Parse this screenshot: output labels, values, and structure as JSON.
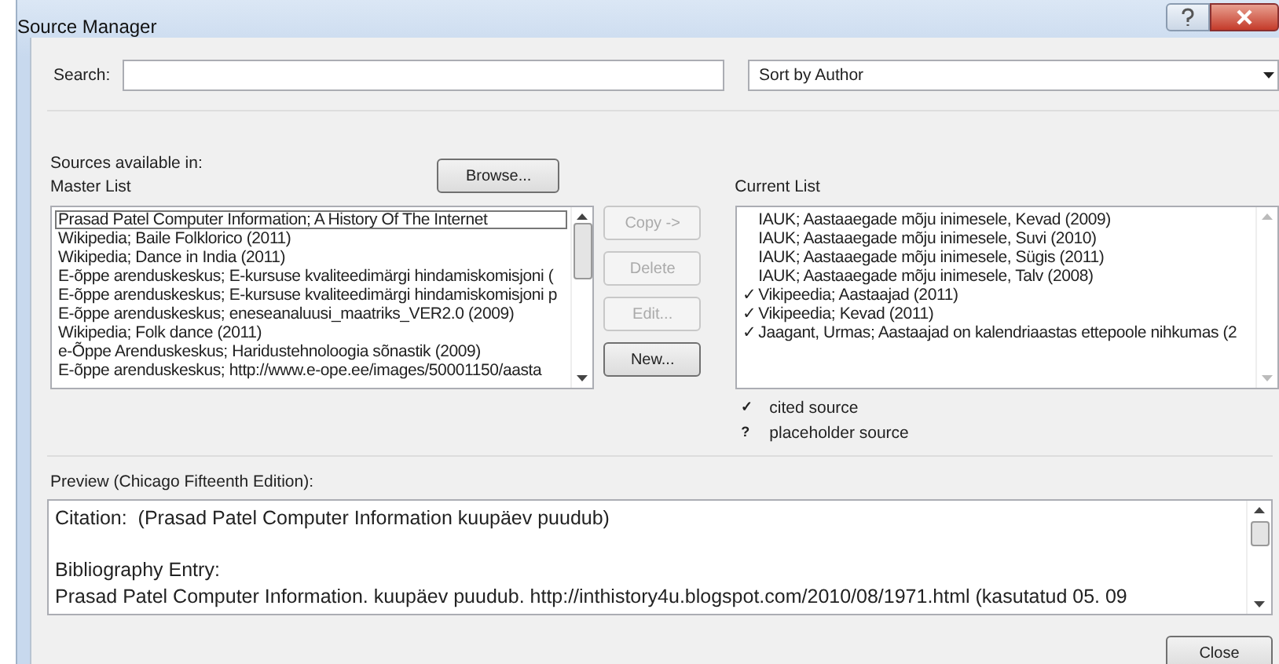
{
  "window": {
    "title": "Source Manager"
  },
  "search": {
    "label": "Search:"
  },
  "sort": {
    "value": "Sort by Author"
  },
  "sources_label": "Sources available in:",
  "master_list": {
    "label": "Master List",
    "browse_button": "Browse...",
    "items": [
      {
        "text": "Prasad Patel Computer Information; A History Of The Internet",
        "selected": true
      },
      {
        "text": "Wikipedia; Baile Folklorico (2011)",
        "selected": false
      },
      {
        "text": "Wikipedia; Dance in India (2011)",
        "selected": false
      },
      {
        "text": "E-õppe arenduskeskus; E-kursuse kvaliteedimärgi hindamiskomisjoni (",
        "selected": false
      },
      {
        "text": "E-õppe arenduskeskus; E-kursuse kvaliteedimärgi hindamiskomisjoni p",
        "selected": false
      },
      {
        "text": "E-õppe arenduskeskus; eneseanaluusi_maatriks_VER2.0 (2009)",
        "selected": false
      },
      {
        "text": "Wikipedia; Folk dance (2011)",
        "selected": false
      },
      {
        "text": "e-Õppe Arenduskeskus; Haridustehnoloogia sõnastik (2009)",
        "selected": false
      },
      {
        "text": "E-õppe arenduskeskus; http://www.e-ope.ee/images/50001150/aasta",
        "selected": false
      }
    ]
  },
  "actions": [
    {
      "label": "Copy ->",
      "disabled": true
    },
    {
      "label": "Delete",
      "disabled": true
    },
    {
      "label": "Edit...",
      "disabled": true
    },
    {
      "label": "New...",
      "disabled": false
    }
  ],
  "current_list": {
    "label": "Current List",
    "items": [
      {
        "text": "IAUK; Aastaaegade mõju inimesele, Kevad (2009)",
        "cited": false
      },
      {
        "text": "IAUK; Aastaaegade mõju inimesele, Suvi (2010)",
        "cited": false
      },
      {
        "text": "IAUK; Aastaaegade mõju inimesele, Sügis (2011)",
        "cited": false
      },
      {
        "text": "IAUK; Aastaaegade mõju inimesele, Talv (2008)",
        "cited": false
      },
      {
        "text": "Vikipeedia; Aastaajad (2011)",
        "cited": true
      },
      {
        "text": "Vikipeedia; Kevad (2011)",
        "cited": true
      },
      {
        "text": "Jaagant, Urmas; Aastaajad on kalendriaastas ettepoole nihkumas (2",
        "cited": true
      }
    ],
    "check_mark": "✓"
  },
  "legend": [
    {
      "symbol": "✓",
      "text": "cited source"
    },
    {
      "symbol": "?",
      "text": "placeholder source"
    }
  ],
  "preview": {
    "label": "Preview (Chicago Fifteenth Edition):",
    "lines": [
      "Citation:  (Prasad Patel Computer Information kuupäev puudub)",
      "Bibliography Entry:",
      "Prasad Patel Computer Information. kuupäev puudub. http://inthistory4u.blogspot.com/2010/08/1971.html (kasutatud 05. 09"
    ]
  },
  "close_button": "Close"
}
